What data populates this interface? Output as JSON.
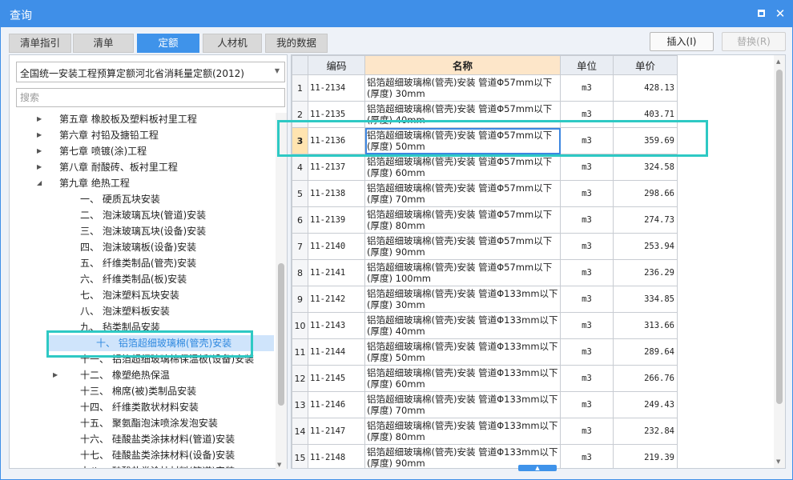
{
  "window": {
    "title": "查询",
    "maximize_icon": "maximize-icon",
    "close_icon": "close-icon",
    "close_glyph": "✕"
  },
  "tabs": [
    {
      "label": "清单指引"
    },
    {
      "label": "清单"
    },
    {
      "label": "定额",
      "active": true
    },
    {
      "label": "人材机"
    },
    {
      "label": "我的数据"
    }
  ],
  "actions": {
    "insert": "插入(I)",
    "replace": "替换(R)"
  },
  "left": {
    "quota_select": "全国统一安装工程预算定额河北省消耗量定额(2012)",
    "search_placeholder": "搜索",
    "tree": [
      {
        "label": "第五章 橡胶板及塑料板衬里工程",
        "expand": "▶"
      },
      {
        "label": "第六章 衬铅及搪铅工程",
        "expand": "▶"
      },
      {
        "label": "第七章 喷镀(涂)工程",
        "expand": "▶"
      },
      {
        "label": "第八章 耐酸砖、板衬里工程",
        "expand": "▶"
      },
      {
        "label": "第九章 绝热工程",
        "expand": "◢"
      },
      {
        "label": "一、 硬质瓦块安装"
      },
      {
        "label": "二、 泡沫玻璃瓦块(管道)安装"
      },
      {
        "label": "三、 泡沫玻璃瓦块(设备)安装"
      },
      {
        "label": "四、 泡沫玻璃板(设备)安装"
      },
      {
        "label": "五、 纤维类制品(管壳)安装"
      },
      {
        "label": "六、 纤维类制品(板)安装"
      },
      {
        "label": "七、 泡沫塑料瓦块安装"
      },
      {
        "label": "八、 泡沫塑料板安装"
      },
      {
        "label": "九、 毡类制品安装"
      },
      {
        "label": "十、 铝箔超细玻璃棉(管壳)安装",
        "selected": true
      },
      {
        "label": "十一、 铝箔超细玻璃棉保温板(设备)安装"
      },
      {
        "label": "十二、 橡塑绝热保温",
        "expand": "▶"
      },
      {
        "label": "十三、 棉席(被)类制品安装"
      },
      {
        "label": "十四、 纤维类散状材料安装"
      },
      {
        "label": "十五、 聚氨酯泡沫喷涂发泡安装"
      },
      {
        "label": "十六、 硅酸盐类涂抹材料(管道)安装"
      },
      {
        "label": "十七、 硅酸盐类涂抹材料(设备)安装"
      },
      {
        "label": "十八、 硅酸盐类涂抹材料(管道)安装"
      }
    ]
  },
  "grid": {
    "headers": {
      "code": "编码",
      "name": "名称",
      "unit": "单位",
      "price": "单价"
    },
    "rows": [
      {
        "no": "1",
        "code": "11-2134",
        "name": "铝箔超细玻璃棉(管壳)安装 管道Φ57mm以下(厚度) 30mm",
        "unit": "m3",
        "price": "428.13"
      },
      {
        "no": "2",
        "code": "11-2135",
        "name": "铝箔超细玻璃棉(管壳)安装 管道Φ57mm以下(厚度) 40mm",
        "unit": "m3",
        "price": "403.71"
      },
      {
        "no": "3",
        "code": "11-2136",
        "name": "铝箔超细玻璃棉(管壳)安装 管道Φ57mm以下(厚度) 50mm",
        "unit": "m3",
        "price": "359.69",
        "selected": true
      },
      {
        "no": "4",
        "code": "11-2137",
        "name": "铝箔超细玻璃棉(管壳)安装 管道Φ57mm以下(厚度) 60mm",
        "unit": "m3",
        "price": "324.58"
      },
      {
        "no": "5",
        "code": "11-2138",
        "name": "铝箔超细玻璃棉(管壳)安装 管道Φ57mm以下(厚度) 70mm",
        "unit": "m3",
        "price": "298.66"
      },
      {
        "no": "6",
        "code": "11-2139",
        "name": "铝箔超细玻璃棉(管壳)安装 管道Φ57mm以下(厚度) 80mm",
        "unit": "m3",
        "price": "274.73"
      },
      {
        "no": "7",
        "code": "11-2140",
        "name": "铝箔超细玻璃棉(管壳)安装 管道Φ57mm以下(厚度) 90mm",
        "unit": "m3",
        "price": "253.94"
      },
      {
        "no": "8",
        "code": "11-2141",
        "name": "铝箔超细玻璃棉(管壳)安装 管道Φ57mm以下(厚度) 100mm",
        "unit": "m3",
        "price": "236.29"
      },
      {
        "no": "9",
        "code": "11-2142",
        "name": "铝箔超细玻璃棉(管壳)安装 管道Φ133mm以下(厚度) 30mm",
        "unit": "m3",
        "price": "334.85"
      },
      {
        "no": "10",
        "code": "11-2143",
        "name": "铝箔超细玻璃棉(管壳)安装 管道Φ133mm以下(厚度) 40mm",
        "unit": "m3",
        "price": "313.66"
      },
      {
        "no": "11",
        "code": "11-2144",
        "name": "铝箔超细玻璃棉(管壳)安装 管道Φ133mm以下(厚度) 50mm",
        "unit": "m3",
        "price": "289.64"
      },
      {
        "no": "12",
        "code": "11-2145",
        "name": "铝箔超细玻璃棉(管壳)安装 管道Φ133mm以下(厚度) 60mm",
        "unit": "m3",
        "price": "266.76"
      },
      {
        "no": "13",
        "code": "11-2146",
        "name": "铝箔超细玻璃棉(管壳)安装 管道Φ133mm以下(厚度) 70mm",
        "unit": "m3",
        "price": "249.43"
      },
      {
        "no": "14",
        "code": "11-2147",
        "name": "铝箔超细玻璃棉(管壳)安装 管道Φ133mm以下(厚度) 80mm",
        "unit": "m3",
        "price": "232.84"
      },
      {
        "no": "15",
        "code": "11-2148",
        "name": "铝箔超细玻璃棉(管壳)安装 管道Φ133mm以下(厚度) 90mm",
        "unit": "m3",
        "price": "219.39"
      }
    ]
  },
  "colors": {
    "accent": "#3f8fe8",
    "highlight_box": "#2ec9c4",
    "selected_tree_bg": "#cfe4fb",
    "name_header_bg": "#fde6c9"
  }
}
